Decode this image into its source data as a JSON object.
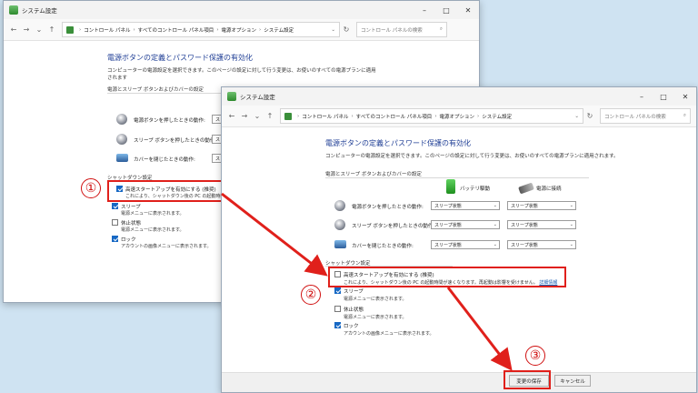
{
  "window_back": {
    "title": "システム設定",
    "address": [
      "コントロール パネル",
      "すべてのコントロール パネル項目",
      "電源オプション",
      "システム設定"
    ],
    "search_placeholder": "コントロール パネルの検索",
    "heading": "電源ボタンの定義とパスワード保護の有効化",
    "description": "コンピューターの電源設定を選択できます。このページの設定に対して行う変更は、お使いのすべての電源プランに適用されます",
    "section_power": "電源とスリープ ボタンおよびカバーの設定",
    "rows": [
      {
        "label": "電源ボタンを押したときの動作:",
        "value": "スリー"
      },
      {
        "label": "スリープ ボタンを押したときの動作:",
        "value": "スリー"
      },
      {
        "label": "カバーを閉じたときの動作:",
        "value": "スリー"
      }
    ],
    "section_shutdown": "シャットダウン設定",
    "options": [
      {
        "label": "高速スタートアップを有効にする (推奨)",
        "desc": "これにより、シャットダウン後の PC の起動時間が",
        "checked": true
      },
      {
        "label": "スリープ",
        "desc": "電源メニューに表示されます。",
        "checked": true
      },
      {
        "label": "休止状態",
        "desc": "電源メニューに表示されます。",
        "checked": false
      },
      {
        "label": "ロック",
        "desc": "アカウントの画像メニューに表示されます。",
        "checked": true
      }
    ]
  },
  "window_front": {
    "title": "システム設定",
    "address": [
      "コントロール パネル",
      "すべてのコントロール パネル項目",
      "電源オプション",
      "システム設定"
    ],
    "search_placeholder": "コントロール パネルの検索",
    "heading": "電源ボタンの定義とパスワード保護の有効化",
    "description": "コンピューターの電源設定を選択できます。このページの設定に対して行う変更は、お使いのすべての電源プランに適用されます。",
    "section_power": "電源とスリープ ボタンおよびカバーの設定",
    "col_battery": "バッテリ駆動",
    "col_ac": "電源に接続",
    "rows": [
      {
        "label": "電源ボタンを押したときの動作:",
        "battery": "スリープ状態",
        "ac": "スリープ状態"
      },
      {
        "label": "スリープ ボタンを押したときの動作:",
        "battery": "スリープ状態",
        "ac": "スリープ状態"
      },
      {
        "label": "カバーを閉じたときの動作:",
        "battery": "スリープ状態",
        "ac": "スリープ状態"
      }
    ],
    "section_shutdown": "シャットダウン設定",
    "options": [
      {
        "label": "高速スタートアップを有効にする (推奨)",
        "desc": "これにより、シャットダウン後の PC の起動時間が速くなります。再起動は影響を受けません。",
        "link": "詳細情報",
        "checked": false
      },
      {
        "label": "スリープ",
        "desc": "電源メニューに表示されます。",
        "checked": true
      },
      {
        "label": "休止状態",
        "desc": "電源メニューに表示されます。",
        "checked": false
      },
      {
        "label": "ロック",
        "desc": "アカウントの画像メニューに表示されます。",
        "checked": true
      }
    ],
    "save_button": "変更の保存",
    "cancel_button": "キャンセル"
  },
  "annotations": {
    "step1": "①",
    "step2": "②",
    "step3": "③",
    "color": "#e0201b"
  }
}
